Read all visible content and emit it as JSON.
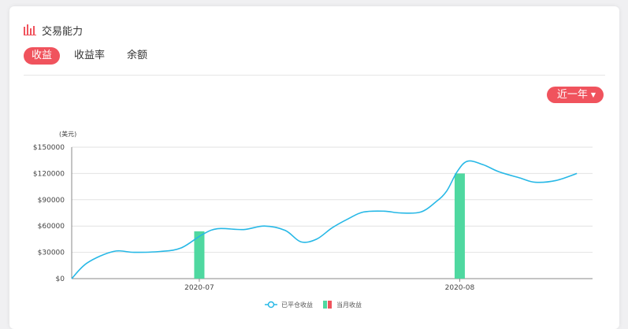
{
  "header": {
    "title": "交易能力",
    "icon": "bar-chart-icon"
  },
  "tabs": [
    {
      "label": "收益",
      "active": true
    },
    {
      "label": "收益率",
      "active": false
    },
    {
      "label": "余额",
      "active": false
    }
  ],
  "range_selector": {
    "label": "近一年",
    "icon": "caret-down-icon"
  },
  "colors": {
    "accent": "#f0535d",
    "line": "#27b8e6",
    "bar": "#4fd8a0"
  },
  "chart_data": {
    "type": "bar+line",
    "ylabel": "(美元)",
    "ylim": [
      0,
      150000
    ],
    "y_ticks": [
      "$150000",
      "$120000",
      "$90000",
      "$60000",
      "$30000",
      "$0"
    ],
    "y_tick_values": [
      150000,
      120000,
      90000,
      60000,
      30000,
      0
    ],
    "x_ticks": [
      "2020-07",
      "2020-08"
    ],
    "x_tick_positions": [
      0.245,
      0.745
    ],
    "x_range": [
      0,
      1
    ],
    "series": [
      {
        "name": "已平仓收益",
        "type": "line",
        "x": [
          0,
          0.03,
          0.08,
          0.12,
          0.17,
          0.21,
          0.25,
          0.28,
          0.33,
          0.37,
          0.41,
          0.44,
          0.47,
          0.5,
          0.53,
          0.56,
          0.6,
          0.63,
          0.67,
          0.7,
          0.72,
          0.74,
          0.76,
          0.79,
          0.82,
          0.86,
          0.89,
          0.93,
          0.97
        ],
        "values": [
          0,
          18000,
          31000,
          30000,
          31000,
          35000,
          50000,
          57000,
          56000,
          60000,
          55000,
          42000,
          45000,
          58000,
          68000,
          76000,
          77000,
          75000,
          76000,
          88000,
          100000,
          122000,
          134000,
          130000,
          122000,
          115000,
          110000,
          112000,
          120000
        ]
      },
      {
        "name": "当月收益",
        "type": "bar",
        "x": [
          0.245,
          0.745
        ],
        "values": [
          54000,
          120000
        ]
      }
    ],
    "legend_position": "bottom-center"
  }
}
